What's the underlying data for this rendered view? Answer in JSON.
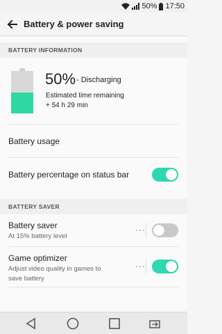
{
  "status_bar": {
    "battery_pct": "50%",
    "time": "17:50"
  },
  "app_bar": {
    "title": "Battery & power saving"
  },
  "battery_info": {
    "header": "BATTERY INFORMATION",
    "percent": "50%",
    "status": "- Discharging",
    "estimate_label": "Estimated time remaining",
    "estimate_value": "+ 54 h 29 min",
    "level": 0.5,
    "fill_color": "#2ed8a2"
  },
  "battery_usage": {
    "label": "Battery usage"
  },
  "percentage_on_status_bar": {
    "label": "Battery percentage on status bar",
    "enabled": true
  },
  "battery_saver_section": {
    "header": "BATTERY SAVER",
    "battery_saver": {
      "label": "Battery saver",
      "sub": "At 15% battery level",
      "enabled": false
    },
    "game_optimizer": {
      "label": "Game optimizer",
      "sub_line1": "Adjust video quality in games to",
      "sub_line2": "save battery",
      "enabled": true
    }
  },
  "colors": {
    "accent": "#2ed8b0",
    "toggle_off": "#c8c8c8"
  },
  "nav_bar": {
    "buttons": [
      "back-icon",
      "home-icon",
      "recents-icon",
      "screen-switch-icon"
    ]
  }
}
